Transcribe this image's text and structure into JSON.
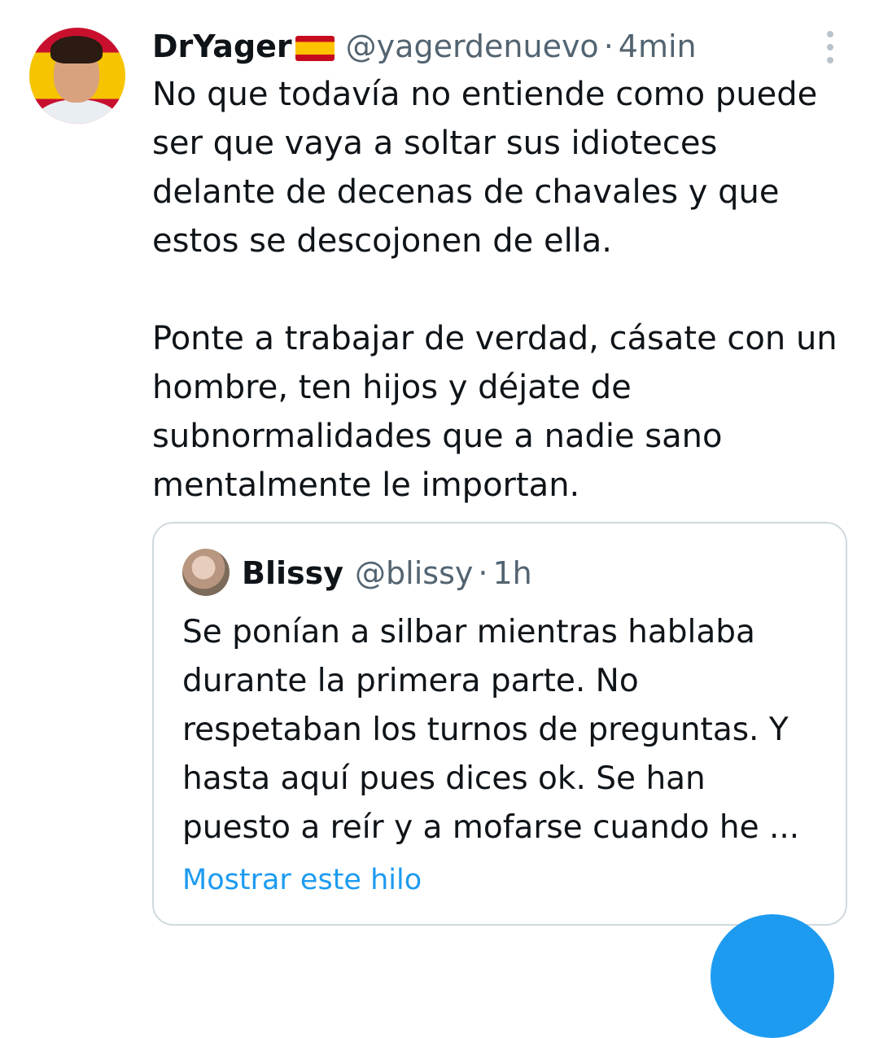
{
  "tweet": {
    "author_name": "DrYager",
    "author_flag": "🇪🇸",
    "handle": "@yagerdenuevo",
    "separator": "·",
    "time": "4min",
    "paragraph1": [
      "No que todavía no entiende como puede",
      "ser que vaya a soltar sus idioteces",
      "delante de decenas de chavales y que",
      "estos se descojonen de ella."
    ],
    "paragraph2": [
      "Ponte a trabajar de verdad, cásate con un",
      "hombre, ten hijos y déjate de",
      "subnormalidades que a nadie sano",
      "mentalmente le importan."
    ]
  },
  "quoted_tweet": {
    "author_name": "Blissy",
    "handle": "@blissy",
    "separator": "·",
    "time": "1h",
    "lines": [
      "Se ponían a silbar mientras hablaba",
      "durante la primera parte. No",
      "respetaban los turnos de preguntas. Y",
      "hasta aquí pues dices ok. Se han",
      "puesto a reír y a mofarse cuando he ..."
    ],
    "show_thread": "Mostrar este hilo"
  },
  "colors": {
    "text": "#0f1419",
    "secondary": "#536471",
    "link": "#1d9bf0",
    "border": "#cfd9de"
  }
}
